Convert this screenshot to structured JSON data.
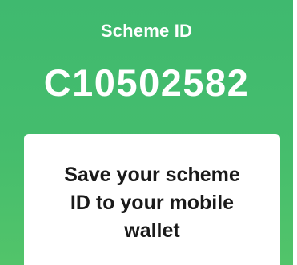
{
  "header": {
    "label": "Scheme ID",
    "scheme_id": "C10502582"
  },
  "card": {
    "message_lines": [
      "Save your scheme",
      "ID to your mobile",
      "wallet"
    ]
  },
  "colors": {
    "background_top": "#3fb96f",
    "background_bottom": "#52c46a",
    "card": "#ffffff",
    "card_text": "#1a1a1a",
    "header_text": "#ffffff"
  }
}
